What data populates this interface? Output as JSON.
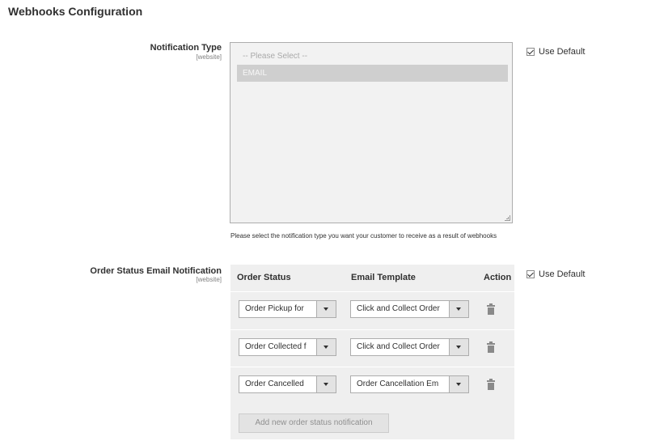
{
  "section": {
    "title": "Webhooks Configuration"
  },
  "notification_type": {
    "label": "Notification Type",
    "scope": "[website]",
    "options": [
      {
        "label": "-- Please Select --",
        "selected": false
      },
      {
        "label": "EMAIL",
        "selected": true
      }
    ],
    "note": "Please select the notification type you want your customer to receive as a result of webhooks",
    "use_default": {
      "label": "Use Default",
      "checked": true
    }
  },
  "order_status_email": {
    "label": "Order Status Email Notification",
    "scope": "[website]",
    "use_default": {
      "label": "Use Default",
      "checked": true
    },
    "columns": [
      "Order Status",
      "Email Template",
      "Action"
    ],
    "rows": [
      {
        "order_status": "Order Pickup for",
        "email_template": "Click and Collect Order"
      },
      {
        "order_status": "Order Collected f",
        "email_template": "Click and Collect Order"
      },
      {
        "order_status": "Order Cancelled",
        "email_template": "Order Cancellation Em"
      }
    ],
    "add_button": "Add new order status notification"
  },
  "icons": {
    "checkbox": "checkmark-icon",
    "dropdown": "chevron-down-icon",
    "delete": "trash-icon"
  }
}
